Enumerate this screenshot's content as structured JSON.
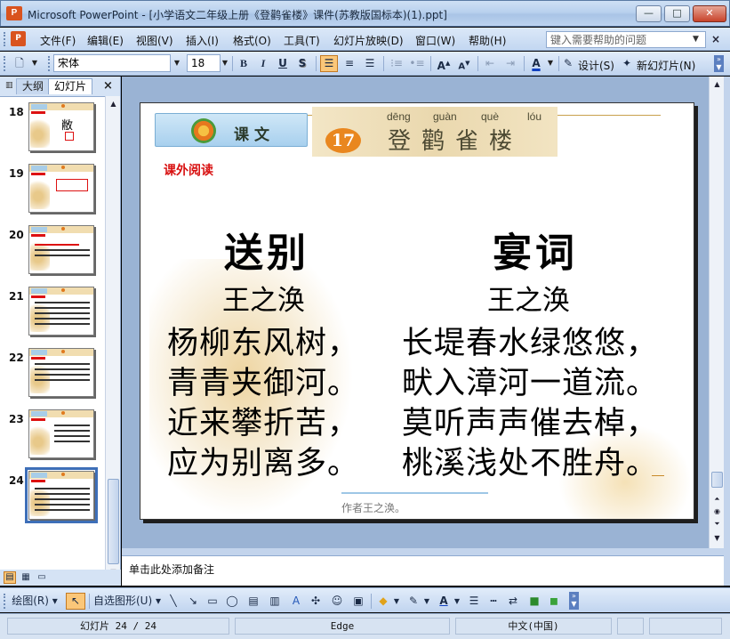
{
  "window": {
    "title": "Microsoft PowerPoint - [小学语文二年级上册《登鹳雀楼》课件(苏教版国标本)(1).ppt]",
    "app_icon": "P",
    "minimize": "—",
    "maximize": "□",
    "close": "✕"
  },
  "menu": {
    "items": [
      "文件(F)",
      "编辑(E)",
      "视图(V)",
      "插入(I)",
      "格式(O)",
      "工具(T)",
      "幻灯片放映(D)",
      "窗口(W)",
      "帮助(H)"
    ],
    "help_placeholder": "键入需要帮助的问题",
    "close_doc": "×"
  },
  "toolbar": {
    "font_name": "宋体",
    "font_size": "18",
    "bold": "B",
    "italic": "I",
    "underline": "U",
    "shadow": "S",
    "design_label": "设计(S)",
    "new_slide_label": "新幻灯片(N)",
    "font_color_letter": "A"
  },
  "left_panel": {
    "tabs": [
      "大纲",
      "幻灯片"
    ],
    "close": "×",
    "slides": [
      {
        "num": "18"
      },
      {
        "num": "19"
      },
      {
        "num": "20"
      },
      {
        "num": "21"
      },
      {
        "num": "22"
      },
      {
        "num": "23"
      },
      {
        "num": "24",
        "selected": true
      }
    ]
  },
  "slide": {
    "header_label": "课文",
    "lesson_number": "17",
    "pinyin": [
      "dēng",
      "guàn",
      "què",
      "lóu"
    ],
    "lesson_title": "登鹳雀楼",
    "section_label": "课外阅读",
    "poems": [
      {
        "title": "送别",
        "author": "王之涣",
        "lines": [
          "杨柳东风树，",
          "青青夹御河。",
          "近来攀折苦，",
          "应为别离多。"
        ]
      },
      {
        "title": "宴词",
        "author": "王之涣",
        "lines": [
          "长堤春水绿悠悠，",
          "畎入漳河一道流。",
          "莫听声声催去棹，",
          "桃溪浅处不胜舟。"
        ]
      }
    ],
    "caption": "作者王之涣。"
  },
  "notes": {
    "placeholder": "单击此处添加备注"
  },
  "drawing_toolbar": {
    "draw_label": "绘图(R)",
    "autoshapes_label": "自选图形(U)"
  },
  "status": {
    "slide_info": "幻灯片 24 / 24",
    "design": "Edge",
    "language": "中文(中国)"
  },
  "colors": {
    "accent_red": "#d81010",
    "lesson_orange": "#e9871f",
    "selection_blue": "#3e6fb8"
  }
}
